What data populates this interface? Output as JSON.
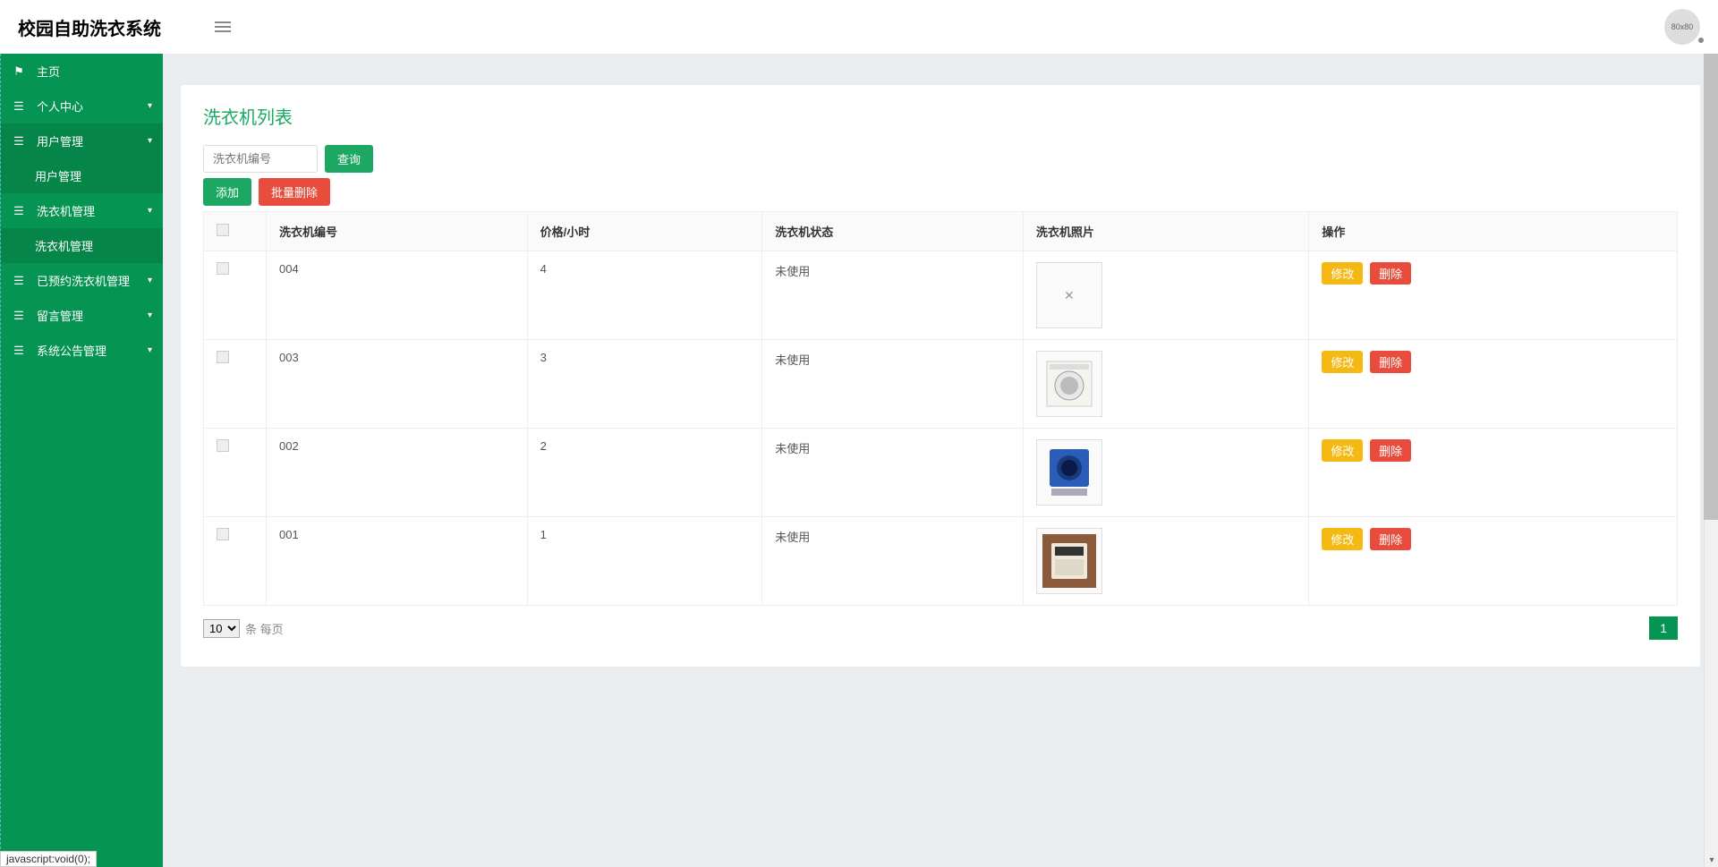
{
  "header": {
    "title": "校园自助洗衣系统",
    "avatar_text": "80x80"
  },
  "sidebar": {
    "items": [
      {
        "label": "主页",
        "icon": "flag",
        "expandable": false
      },
      {
        "label": "个人中心",
        "icon": "list",
        "expandable": true
      },
      {
        "label": "用户管理",
        "icon": "list",
        "expandable": true,
        "active": true
      },
      {
        "label": "用户管理",
        "sub": true
      },
      {
        "label": "洗衣机管理",
        "icon": "list",
        "expandable": true
      },
      {
        "label": "洗衣机管理",
        "sub": true
      },
      {
        "label": "已预约洗衣机管理",
        "icon": "list",
        "expandable": true
      },
      {
        "label": "留言管理",
        "icon": "list",
        "expandable": true
      },
      {
        "label": "系统公告管理",
        "icon": "list",
        "expandable": true
      }
    ]
  },
  "page": {
    "title": "洗衣机列表",
    "search_placeholder": "洗衣机编号",
    "search_button": "查询",
    "add_button": "添加",
    "bulk_delete_button": "批量删除"
  },
  "table": {
    "headers": [
      "",
      "洗衣机编号",
      "价格/小时",
      "洗衣机状态",
      "洗衣机照片",
      "操作"
    ],
    "rows": [
      {
        "id": "004",
        "price": "4",
        "status": "未使用",
        "photo": "broken"
      },
      {
        "id": "003",
        "price": "3",
        "status": "未使用",
        "photo": "washer-white"
      },
      {
        "id": "002",
        "price": "2",
        "status": "未使用",
        "photo": "washer-blue"
      },
      {
        "id": "001",
        "price": "1",
        "status": "未使用",
        "photo": "washer-cream"
      }
    ],
    "actions": {
      "edit": "修改",
      "delete": "删除"
    }
  },
  "pagination": {
    "per_page_options": [
      "10"
    ],
    "selected": "10",
    "label": "条 每页",
    "current_page": "1"
  },
  "status_bar": "javascript:void(0);"
}
